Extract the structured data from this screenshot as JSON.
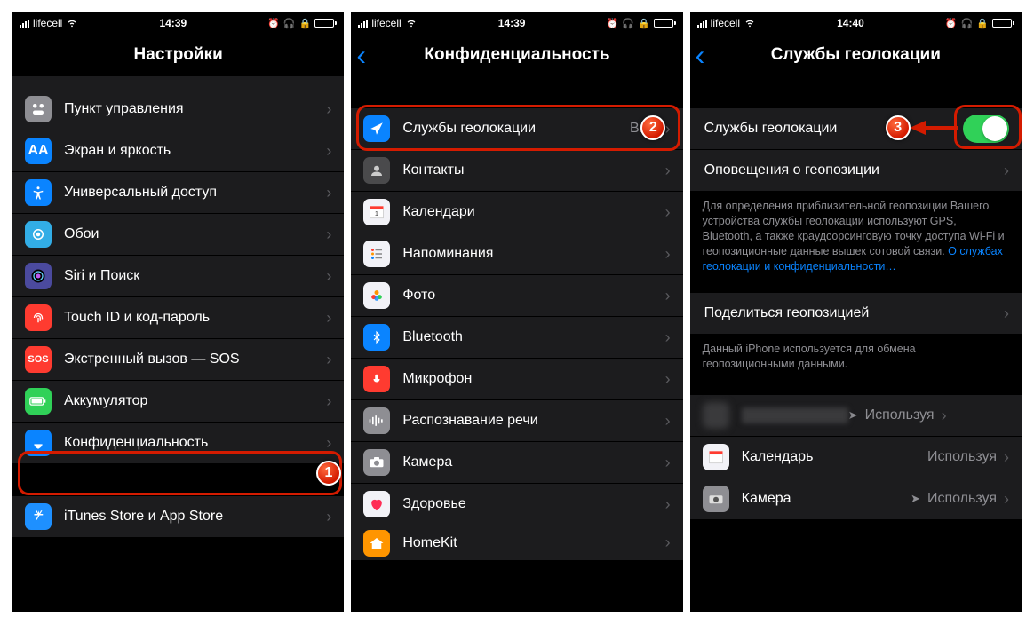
{
  "status": {
    "carrier": "lifecell",
    "time1": "14:39",
    "time2": "14:39",
    "time3": "14:40"
  },
  "p1": {
    "title": "Настройки",
    "rows": {
      "control": "Пункт управления",
      "display": "Экран и яркость",
      "access": "Универсальный доступ",
      "wallpaper": "Обои",
      "siri": "Siri и Поиск",
      "touchid": "Touch ID и код-пароль",
      "sos": "Экстренный вызов — SOS",
      "sos_badge": "SOS",
      "battery": "Аккумулятор",
      "privacy": "Конфиденциальность",
      "itunes": "iTunes Store и App Store"
    }
  },
  "p2": {
    "title": "Конфиденциальность",
    "rows": {
      "location": "Службы геолокации",
      "location_val": "Вкл.",
      "contacts": "Контакты",
      "calendars": "Календари",
      "reminders": "Напоминания",
      "photos": "Фото",
      "bluetooth": "Bluetooth",
      "mic": "Микрофон",
      "speech": "Распознавание речи",
      "camera": "Камера",
      "health": "Здоровье",
      "homekit": "HomeKit"
    }
  },
  "p3": {
    "title": "Службы геолокации",
    "rows": {
      "toggle": "Службы геолокации",
      "alerts": "Оповещения о геопозиции",
      "share": "Поделиться геопозицией",
      "app_cal": "Календарь",
      "app_cam": "Камера",
      "using": "Используя"
    },
    "foot1": "Для определения приблизительной геопозиции Вашего устройства службы геолокации используют GPS, Bluetooth, а также краудсорсинговую точку доступа Wi-Fi и геопозиционные данные вышек сотовой связи. ",
    "foot1_link": "О службах геолокации и конфиденциальности…",
    "foot2": "Данный iPhone используется для обмена геопозиционными данными."
  },
  "badges": {
    "b1": "1",
    "b2": "2",
    "b3": "3"
  }
}
